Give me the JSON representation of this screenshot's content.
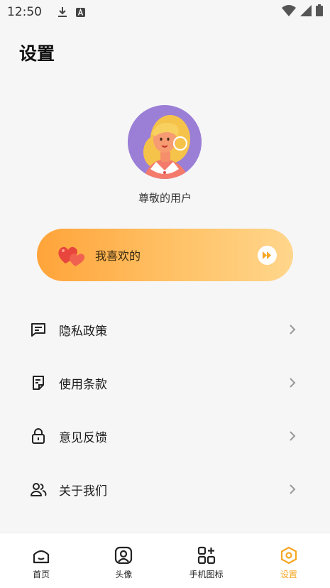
{
  "status_bar": {
    "time": "12:50",
    "icons": [
      "download-icon",
      "a-badge-icon",
      "wifi-icon",
      "signal-icon",
      "battery-icon"
    ]
  },
  "page": {
    "title": "设置"
  },
  "profile": {
    "name": "尊敬的用户",
    "avatar": "cartoon-girl-avatar"
  },
  "favorites": {
    "label": "我喜欢的",
    "icon": "hearts-icon",
    "action_icon": "play-forward-icon"
  },
  "menu": [
    {
      "label": "隐私政策",
      "icon": "message-square-icon"
    },
    {
      "label": "使用条款",
      "icon": "document-icon"
    },
    {
      "label": "意见反馈",
      "icon": "lock-icon"
    },
    {
      "label": "关于我们",
      "icon": "users-icon"
    }
  ],
  "tabs": [
    {
      "label": "首页",
      "icon": "home-icon",
      "active": false
    },
    {
      "label": "头像",
      "icon": "avatar-icon",
      "active": false
    },
    {
      "label": "手机图标",
      "icon": "app-grid-icon",
      "active": false
    },
    {
      "label": "设置",
      "icon": "settings-hex-icon",
      "active": true
    }
  ],
  "colors": {
    "accent": "#f5a623",
    "background": "#f6f6f7",
    "avatar_bg": "#9b7fd6"
  }
}
